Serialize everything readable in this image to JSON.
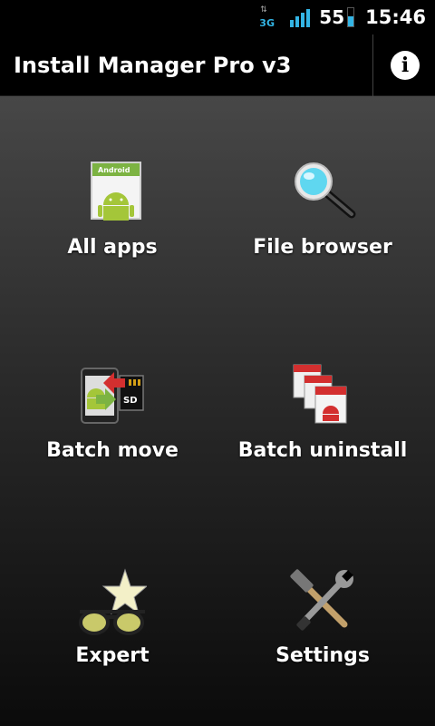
{
  "status_bar": {
    "network": "3G",
    "battery_level": "55",
    "time": "15:46"
  },
  "app": {
    "title": "Install Manager Pro v3",
    "info_icon": "info-icon"
  },
  "menu": [
    {
      "label": "All apps",
      "icon": "android-app-icon"
    },
    {
      "label": "File browser",
      "icon": "magnifier-icon"
    },
    {
      "label": "Batch move",
      "icon": "phone-to-sd-icon"
    },
    {
      "label": "Batch uninstall",
      "icon": "stacked-apps-delete-icon"
    },
    {
      "label": "Expert",
      "icon": "star-sunglasses-icon"
    },
    {
      "label": "Settings",
      "icon": "tools-icon"
    }
  ],
  "icon_text": {
    "android": "Android"
  },
  "colors": {
    "accent": "#33b5e5",
    "android_green": "#a4c639",
    "uninstall_red": "#d32f2f"
  }
}
